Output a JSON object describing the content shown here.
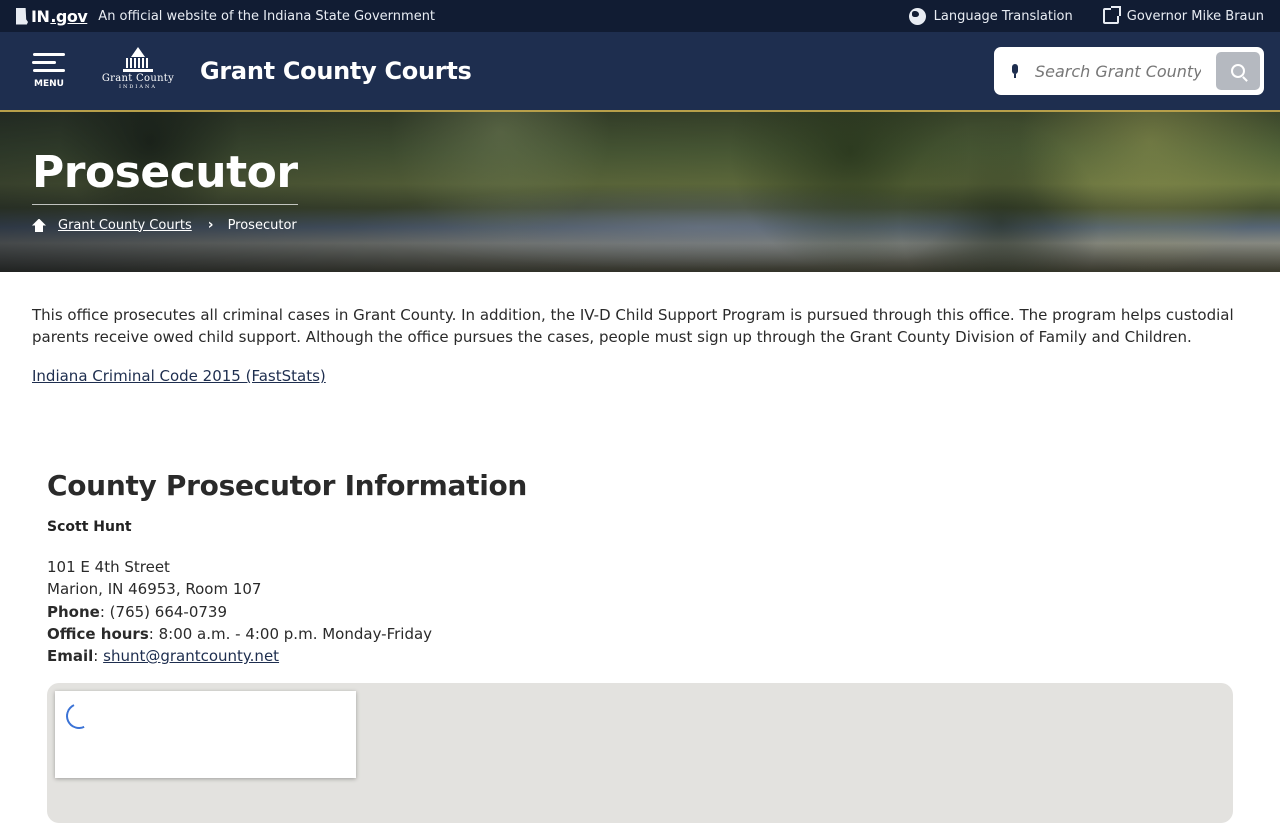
{
  "topbar": {
    "ingov_prefix": "IN",
    "ingov_suffix": ".gov",
    "official_text": "An official website of the Indiana State Government",
    "language_label": "Language Translation",
    "governor_label": "Governor Mike Braun"
  },
  "header": {
    "menu_label": "MENU",
    "logo_line1": "Grant County",
    "logo_line2": "INDIANA",
    "site_title": "Grant County Courts",
    "search_placeholder": "Search Grant County"
  },
  "hero": {
    "title": "Prosecutor",
    "breadcrumb": [
      {
        "label": "Grant County Courts"
      },
      {
        "label": "Prosecutor"
      }
    ]
  },
  "intro": {
    "paragraph": "This office prosecutes all criminal cases in Grant County. In addition, the IV-D Child Support Program is pursued through this office. The program helps custodial parents receive owed child support. Although the office pursues the cases, people must sign up through the Grant County Division of Family and Children.",
    "link": "Indiana Criminal Code 2015 (FastStats)"
  },
  "info": {
    "heading": "County Prosecutor Information",
    "name": "Scott Hunt",
    "street": "101 E 4th Street",
    "city": "Marion, IN 46953, Room 107",
    "phone_label": "Phone",
    "phone": "(765) 664-0739",
    "hours_label": "Office hours",
    "hours": "8:00 a.m. - 4:00 p.m. Monday-Friday",
    "email_label": "Email",
    "email": "shunt@grantcounty.net"
  },
  "colors": {
    "topbar": "#111c33",
    "header": "#1e2e4f",
    "accent_gold": "#b79f4a",
    "search_button": "#b5b9c0"
  },
  "icons": [
    "indiana-state-icon",
    "globe-icon",
    "external-link-icon",
    "menu-icon",
    "microphone-icon",
    "search-icon",
    "home-icon",
    "chevron-right-icon",
    "loading-spinner-icon"
  ]
}
